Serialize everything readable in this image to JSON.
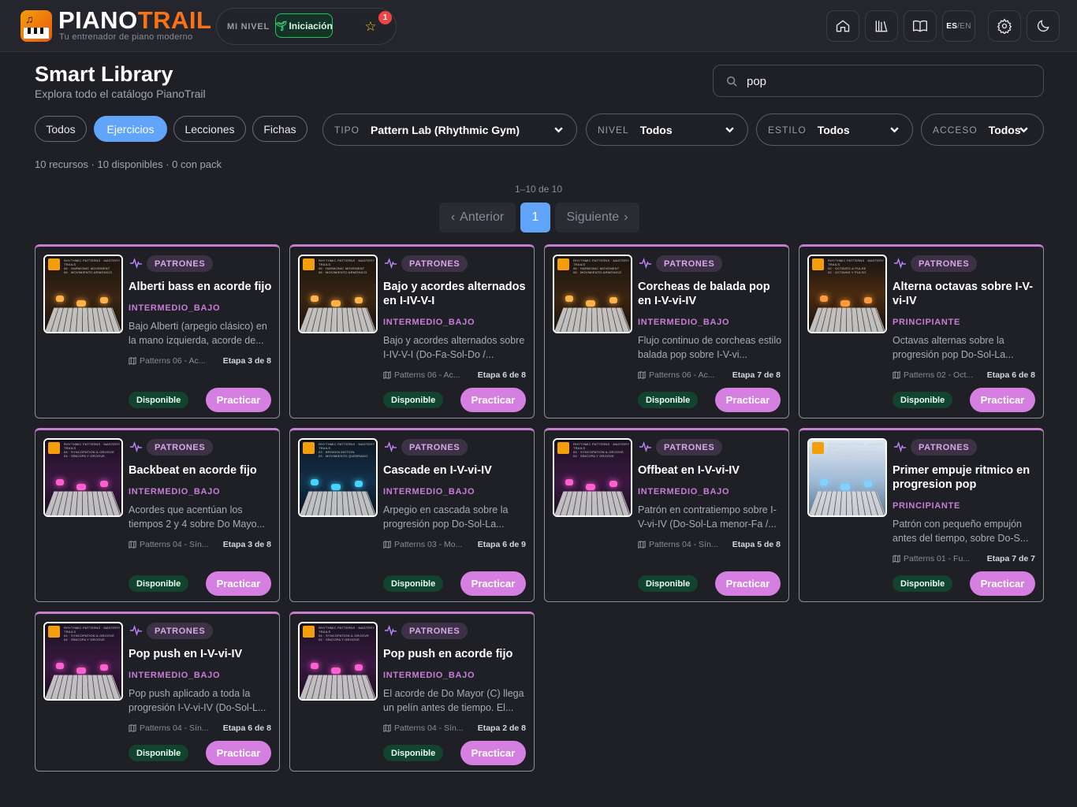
{
  "header": {
    "brand_part1": "PIANO",
    "brand_part2": "TRAIL",
    "tagline": "Tu entrenador de piano moderno",
    "level_label": "MI NIVEL",
    "level_value": "Iniciación",
    "notification_count": "1",
    "lang_on": "ES",
    "lang_sep": " / ",
    "lang_off": "EN",
    "icons": [
      "home-icon",
      "library-icon",
      "book-icon",
      "settings-icon",
      "moon-icon"
    ]
  },
  "page": {
    "title": "Smart Library",
    "subtitle": "Explora todo el catálogo PianoTrail"
  },
  "search": {
    "value": "pop",
    "placeholder": ""
  },
  "filters": {
    "chips": [
      "Todos",
      "Ejercicios",
      "Lecciones",
      "Fichas"
    ],
    "active_chip": "Ejercicios",
    "tipo_label": "TIPO",
    "tipo_value": "Pattern Lab (Rhythmic Gym)",
    "nivel_label": "NIVEL",
    "nivel_value": "Todos",
    "estilo_label": "ESTILO",
    "estilo_value": "Todos",
    "acceso_label": "ACCESO",
    "acceso_value": "Todos"
  },
  "stats": "10 recursos · 10 disponibles · 0 con pack",
  "pagination": {
    "range": "1–10 de 10",
    "prev": "Anterior",
    "current": "1",
    "next": "Siguiente"
  },
  "cards": [
    {
      "tag": "PATRONES",
      "title": "Alberti bass en acorde fijo",
      "level": "INTERMEDIO_BAJO",
      "desc": "Bajo Alberti (arpegio clásico) en la mano izquierda, acorde de...",
      "pack": "Patterns 06 - Ac...",
      "stage": "Etapa 3 de 8",
      "status": "Disponible",
      "action": "Practicar",
      "thumb_line1": "06 · HARMONIC MOVEMENT",
      "thumb_line2": "06 · MOVIMIENTO ARMÓNICO",
      "theme": "orange"
    },
    {
      "tag": "PATRONES",
      "title": "Bajo y acordes alternados en I-IV-V-I",
      "level": "INTERMEDIO_BAJO",
      "desc": "Bajo y acordes alternados sobre I-IV-V-I (Do-Fa-Sol-Do /...",
      "pack": "Patterns 06 - Ac...",
      "stage": "Etapa 6 de 8",
      "status": "Disponible",
      "action": "Practicar",
      "thumb_line1": "06 · HARMONIC MOVEMENT",
      "thumb_line2": "06 · MOVIMIENTO ARMÓNICO",
      "theme": "orange"
    },
    {
      "tag": "PATRONES",
      "title": "Corcheas de balada pop en I-V-vi-IV",
      "level": "INTERMEDIO_BAJO",
      "desc": "Flujo continuo de corcheas estilo balada pop sobre I-V-vi...",
      "pack": "Patterns 06 - Ac...",
      "stage": "Etapa 7 de 8",
      "status": "Disponible",
      "action": "Practicar",
      "thumb_line1": "06 · HARMONIC MOVEMENT",
      "thumb_line2": "06 · MOVIMIENTO ARMÓNICO",
      "theme": "orange"
    },
    {
      "tag": "PATRONES",
      "title": "Alterna octavas sobre I-V-vi-IV",
      "level": "PRINCIPIANTE",
      "desc": "Octavas alternas sobre la progresión pop Do-Sol-La...",
      "pack": "Patterns 02 - Oct...",
      "stage": "Etapa 6 de 8",
      "status": "Disponible",
      "action": "Practicar",
      "thumb_line1": "02 · OCTAVES & PULSE",
      "thumb_line2": "02 · OCTAVAS Y PULSO",
      "theme": "amber"
    },
    {
      "tag": "PATRONES",
      "title": "Backbeat en acorde fijo",
      "level": "INTERMEDIO_BAJO",
      "desc": "Acordes que acentúan los tiempos 2 y 4 sobre Do Mayo...",
      "pack": "Patterns 04 - Sín...",
      "stage": "Etapa 3 de 8",
      "status": "Disponible",
      "action": "Practicar",
      "thumb_line1": "04 · SYNCOPATION & GROOVE",
      "thumb_line2": "04 · SÍNCOPA Y GROOVE",
      "theme": "magenta"
    },
    {
      "tag": "PATRONES",
      "title": "Cascade en I-V-vi-IV",
      "level": "INTERMEDIO_BAJO",
      "desc": "Arpegio en cascada sobre la progresión pop Do-Sol-La...",
      "pack": "Patterns 03 - Mo...",
      "stage": "Etapa 6 de 9",
      "status": "Disponible",
      "action": "Practicar",
      "thumb_line1": "03 · BROKEN MOTION",
      "thumb_line2": "03 · MOVIMIENTO QUEBRADO",
      "theme": "cyan"
    },
    {
      "tag": "PATRONES",
      "title": "Offbeat en I-V-vi-IV",
      "level": "INTERMEDIO_BAJO",
      "desc": "Patrón en contratiempo sobre I-V-vi-IV (Do-Sol-La menor-Fa /...",
      "pack": "Patterns 04 - Sín...",
      "stage": "Etapa 5 de 8",
      "status": "Disponible",
      "action": "Practicar",
      "thumb_line1": "04 · SYNCOPATION & GROOVE",
      "thumb_line2": "04 · SÍNCOPA Y GROOVE",
      "theme": "magenta"
    },
    {
      "tag": "PATRONES",
      "title": "Primer empuje ritmico en progresion pop",
      "level": "PRINCIPIANTE",
      "desc": "Patrón con pequeño empujón antes del tiempo, sobre Do-S...",
      "pack": "Patterns 01 - Fu...",
      "stage": "Etapa 7 de 7",
      "status": "Disponible",
      "action": "Practicar",
      "thumb_line1": "01 · DIDACTIC FOUNDATIONS",
      "thumb_line2": "01 · FUNDAMENTOS DIDÁCTICOS",
      "theme": "ice"
    },
    {
      "tag": "PATRONES",
      "title": "Pop push en I-V-vi-IV",
      "level": "INTERMEDIO_BAJO",
      "desc": "Pop push aplicado a toda la progresión I-V-vi-IV (Do-Sol-L...",
      "pack": "Patterns 04 - Sín...",
      "stage": "Etapa 6 de 8",
      "status": "Disponible",
      "action": "Practicar",
      "thumb_line1": "04 · SYNCOPATION & GROOVE",
      "thumb_line2": "04 · SÍNCOPA Y GROOVE",
      "theme": "magenta"
    },
    {
      "tag": "PATRONES",
      "title": "Pop push en acorde fijo",
      "level": "INTERMEDIO_BAJO",
      "desc": "El acorde de Do Mayor (C) llega un pelín antes de tiempo. El...",
      "pack": "Patterns 04 - Sín...",
      "stage": "Etapa 2 de 8",
      "status": "Disponible",
      "action": "Practicar",
      "thumb_line1": "04 · SYNCOPATION & GROOVE",
      "thumb_line2": "04 · SÍNCOPA Y GROOVE",
      "theme": "magenta"
    }
  ],
  "thumb_series": "RHYTHMIC PATTERNS · MASTERY TRAILS",
  "colors": {
    "accent_blue": "#60a5fa",
    "accent_pink": "#d57fe0",
    "brand_orange": "#f97316",
    "available_green": "#12432e"
  }
}
